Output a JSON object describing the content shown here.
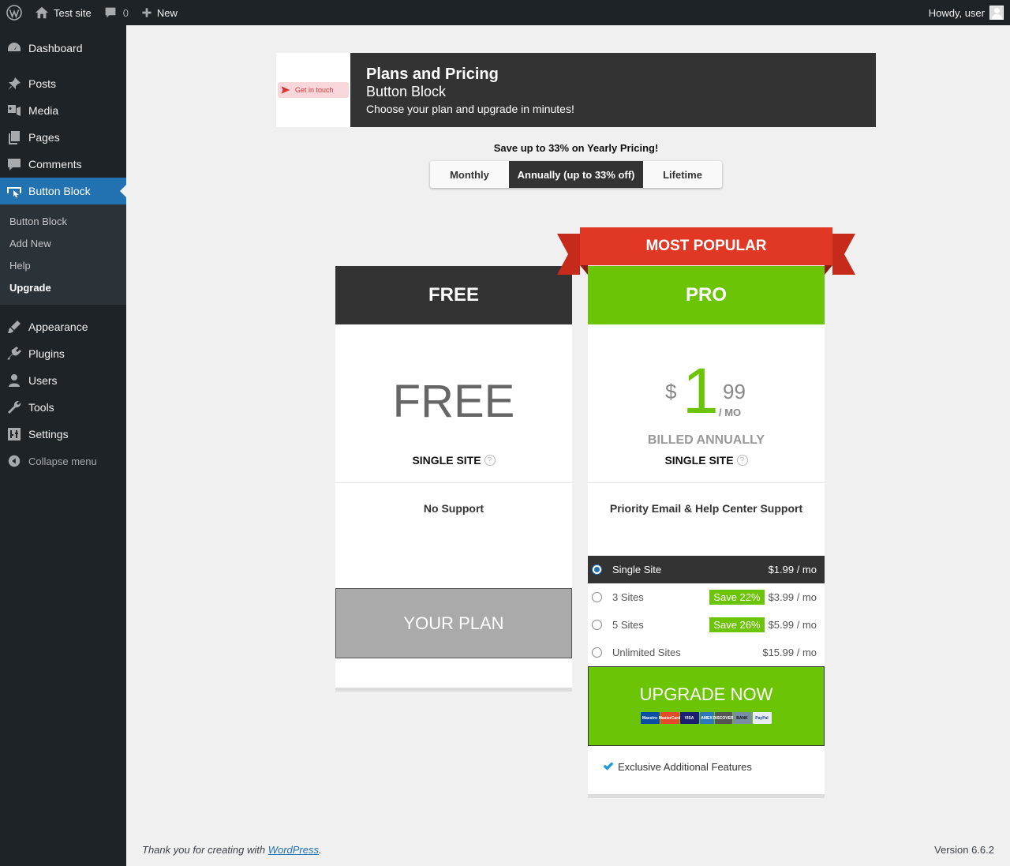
{
  "adminbar": {
    "site_name": "Test site",
    "comments_count": "0",
    "new_label": "New",
    "howdy": "Howdy, user"
  },
  "sidebar": {
    "items": [
      {
        "label": "Dashboard",
        "icon": "dashboard-icon"
      },
      {
        "label": "Posts",
        "icon": "pin-icon"
      },
      {
        "label": "Media",
        "icon": "media-icon"
      },
      {
        "label": "Pages",
        "icon": "pages-icon"
      },
      {
        "label": "Comments",
        "icon": "comment-icon"
      },
      {
        "label": "Button Block",
        "icon": "button-icon"
      },
      {
        "label": "Appearance",
        "icon": "brush-icon"
      },
      {
        "label": "Plugins",
        "icon": "plug-icon"
      },
      {
        "label": "Users",
        "icon": "user-icon"
      },
      {
        "label": "Tools",
        "icon": "wrench-icon"
      },
      {
        "label": "Settings",
        "icon": "sliders-icon"
      }
    ],
    "submenu": [
      "Button Block",
      "Add New",
      "Help",
      "Upgrade"
    ],
    "collapse": "Collapse menu"
  },
  "header": {
    "thumb_text": "Get in touch",
    "title": "Plans and Pricing",
    "subtitle": "Button Block",
    "description": "Choose your plan and upgrade in minutes!"
  },
  "billing": {
    "note": "Save up to 33% on Yearly Pricing!",
    "monthly": "Monthly",
    "annual": "Annually (up to 33% off)",
    "lifetime": "Lifetime"
  },
  "free_plan": {
    "name": "FREE",
    "price": "FREE",
    "sites": "SINGLE SITE",
    "support": "No Support",
    "button": "YOUR PLAN"
  },
  "pro_plan": {
    "ribbon": "MOST POPULAR",
    "name": "PRO",
    "currency": "$",
    "price_int": "1",
    "price_dec": "99",
    "per": "/ MO",
    "billed": "BILLED ANNUALLY",
    "sites": "SINGLE SITE",
    "support": "Priority Email & Help Center Support",
    "options": [
      {
        "label": "Single Site",
        "price": "$1.99 / mo",
        "save": ""
      },
      {
        "label": "3 Sites",
        "price": "$3.99 / mo",
        "save": "Save 22%"
      },
      {
        "label": "5 Sites",
        "price": "$5.99 / mo",
        "save": "Save 26%"
      },
      {
        "label": "Unlimited Sites",
        "price": "$15.99 / mo",
        "save": ""
      }
    ],
    "button": "UPGRADE NOW",
    "payments": [
      {
        "label": "Maestro",
        "color": "#0b4ea2"
      },
      {
        "label": "MasterCard",
        "color": "#e24a2b"
      },
      {
        "label": "VISA",
        "color": "#1a1f71"
      },
      {
        "label": "AMEX",
        "color": "#2e77bb"
      },
      {
        "label": "DISCOVER",
        "color": "#555555"
      },
      {
        "label": "BANK",
        "color": "#7a8da3"
      },
      {
        "label": "PayPal",
        "color": "#e8edf3"
      }
    ],
    "feature": "Exclusive Additional Features"
  },
  "footer": {
    "thanks_prefix": "Thank you for creating with ",
    "link": "WordPress",
    "suffix": ".",
    "version": "Version 6.6.2"
  },
  "colors": {
    "accent": "#2271b1",
    "pro_green": "#6bc406",
    "ribbon_red": "#e13826",
    "dark": "#333333"
  }
}
